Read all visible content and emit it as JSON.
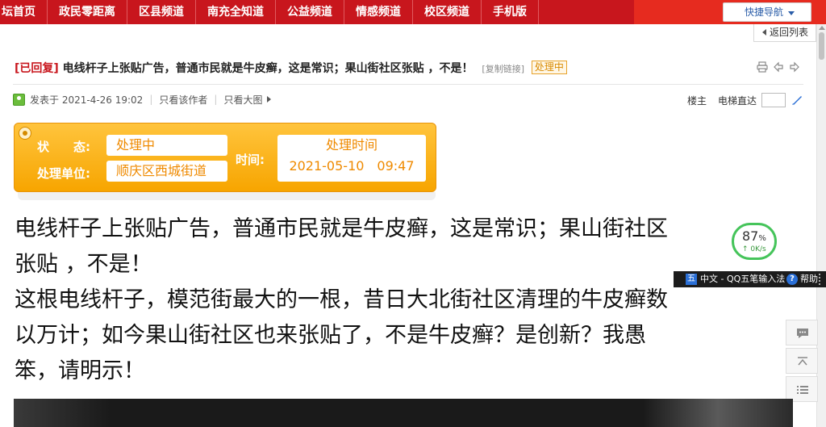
{
  "nav": {
    "items": [
      "坛首页",
      "政民零距离",
      "区县频道",
      "南充全知道",
      "公益频道",
      "情感频道",
      "校区频道",
      "手机版"
    ],
    "quick_nav": "快捷导航"
  },
  "back_to_list": "返回列表",
  "post": {
    "tag": "[已回复]",
    "title": "电线杆子上张贴广告，普通市民就是牛皮癣，这是常识；果山街社区张贴 ，不是！",
    "copy_link": "[复制链接]",
    "status_badge": "处理中"
  },
  "meta": {
    "posted": "发表于 2021-4-26 19:02",
    "only_author": "只看该作者",
    "only_images": "只看大图",
    "floor": "楼主",
    "elevator": "电梯直达"
  },
  "status_box": {
    "status_label": "状　　态:",
    "status_value": "处理中",
    "unit_label": "处理单位:",
    "unit_value": "顺庆区西城街道",
    "time_label": "时间:",
    "time_title": "处理时间",
    "time_value": "2021-05-10　09:47"
  },
  "content": {
    "line1": "电线杆子上张贴广告，普通市民就是牛皮癣，这是常识；果山街社区",
    "line2": "张贴 ，不是！",
    "line3": "这根电线杆子，模范街最大的一根，昔日大北街社区清理的牛皮癣数",
    "line4": "以万计；如今果山街社区也来张贴了，不是牛皮癣？是创新？我愚",
    "line5": "笨，请明示！"
  },
  "speed_widget": {
    "percent": "87",
    "percent_unit": "%",
    "rate": "↑ 0K/s"
  },
  "ime": {
    "logo": "五",
    "name": "中文 - QQ五笔输入法",
    "help_icon": "?",
    "help": "帮助"
  },
  "icons": [
    "print-icon",
    "prev-icon",
    "next-icon",
    "comment-icon",
    "top-icon",
    "list-icon",
    "pen-icon"
  ]
}
